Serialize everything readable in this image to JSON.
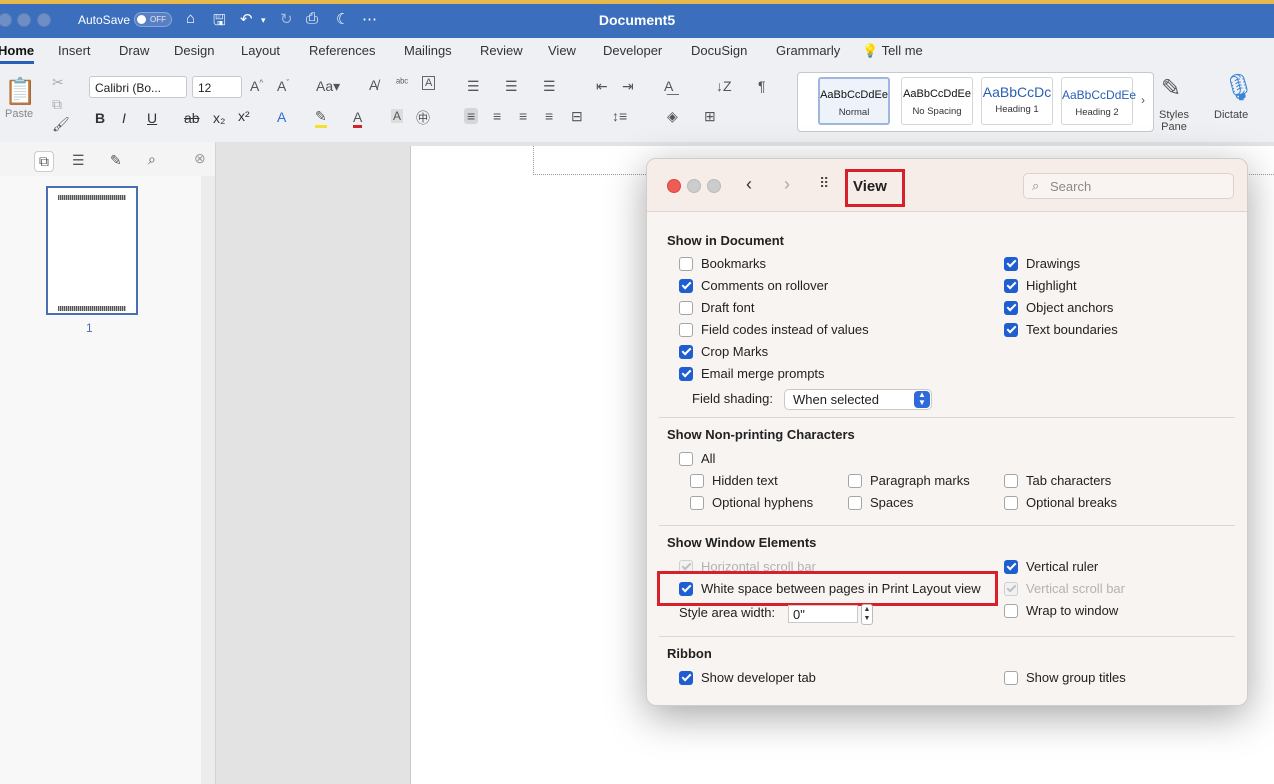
{
  "app": {
    "document_title": "Document5",
    "autosave_label": "AutoSave",
    "autosave_state": "OFF"
  },
  "tabs": [
    "Home",
    "Insert",
    "Draw",
    "Design",
    "Layout",
    "References",
    "Mailings",
    "Review",
    "View",
    "Developer",
    "DocuSign",
    "Grammarly"
  ],
  "tell_me": "Tell me",
  "ribbon": {
    "paste_label": "Paste",
    "font_name": "Calibri (Bo...",
    "font_size": "12",
    "styles": [
      {
        "sample": "AaBbCcDdEe",
        "name": "Normal"
      },
      {
        "sample": "AaBbCcDdEe",
        "name": "No Spacing"
      },
      {
        "sample": "AaBbCcDc",
        "name": "Heading 1"
      },
      {
        "sample": "AaBbCcDdEe",
        "name": "Heading 2"
      }
    ],
    "styles_pane_label": "Styles Pane",
    "dictate_label": "Dictate"
  },
  "nav_pane": {
    "page_number": "1"
  },
  "dialog": {
    "title": "View",
    "search_placeholder": "Search",
    "show_in_document": {
      "heading": "Show in Document",
      "left": [
        {
          "label": "Bookmarks",
          "checked": false
        },
        {
          "label": "Comments on rollover",
          "checked": true
        },
        {
          "label": "Draft font",
          "checked": false
        },
        {
          "label": "Field codes instead of values",
          "checked": false
        },
        {
          "label": "Crop Marks",
          "checked": true
        },
        {
          "label": "Email merge prompts",
          "checked": true
        }
      ],
      "right": [
        {
          "label": "Drawings",
          "checked": true
        },
        {
          "label": "Highlight",
          "checked": true
        },
        {
          "label": "Object anchors",
          "checked": true
        },
        {
          "label": "Text boundaries",
          "checked": true
        }
      ],
      "field_shading_label": "Field shading:",
      "field_shading_value": "When selected"
    },
    "non_printing": {
      "heading": "Show Non-printing Characters",
      "all": {
        "label": "All",
        "checked": false
      },
      "items": [
        {
          "label": "Hidden text",
          "checked": false
        },
        {
          "label": "Paragraph marks",
          "checked": false
        },
        {
          "label": "Tab characters",
          "checked": false
        },
        {
          "label": "Optional hyphens",
          "checked": false
        },
        {
          "label": "Spaces",
          "checked": false
        },
        {
          "label": "Optional breaks",
          "checked": false
        }
      ]
    },
    "window_elements": {
      "heading": "Show Window Elements",
      "horizontal_scroll_bar": {
        "label": "Horizontal scroll bar",
        "checked": true,
        "disabled": true
      },
      "white_space": {
        "label": "White space between pages in Print Layout view",
        "checked": true
      },
      "style_area_label": "Style area width:",
      "style_area_value": "0\"",
      "vertical_ruler": {
        "label": "Vertical ruler",
        "checked": true
      },
      "vertical_scroll_bar": {
        "label": "Vertical scroll bar",
        "checked": true,
        "disabled": true
      },
      "wrap_to_window": {
        "label": "Wrap to window",
        "checked": false
      }
    },
    "ribbon_section": {
      "heading": "Ribbon",
      "show_developer_tab": {
        "label": "Show developer tab",
        "checked": true
      },
      "show_group_titles": {
        "label": "Show group titles",
        "checked": false
      }
    }
  },
  "colors": {
    "titlebar": "#3b6fbd",
    "accent": "#1f5ed1",
    "highlight_box": "#d81f2a"
  }
}
